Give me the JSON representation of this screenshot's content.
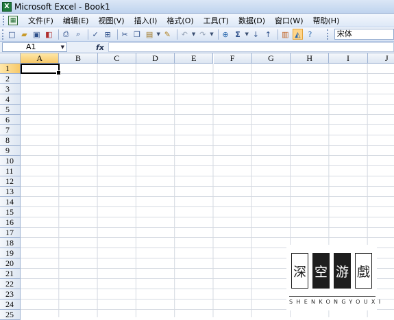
{
  "window": {
    "title": "Microsoft Excel - Book1",
    "app_icon": "excel-icon"
  },
  "menu": [
    {
      "label": "文件(F)"
    },
    {
      "label": "编辑(E)"
    },
    {
      "label": "视图(V)"
    },
    {
      "label": "插入(I)"
    },
    {
      "label": "格式(O)"
    },
    {
      "label": "工具(T)"
    },
    {
      "label": "数据(D)"
    },
    {
      "label": "窗口(W)"
    },
    {
      "label": "帮助(H)"
    }
  ],
  "toolbar": {
    "font_name": "宋体"
  },
  "formula_bar": {
    "cell_ref": "A1",
    "fx_label": "fx",
    "value": ""
  },
  "grid": {
    "columns": [
      "A",
      "B",
      "C",
      "D",
      "E",
      "F",
      "G",
      "H",
      "I",
      "J"
    ],
    "rows": [
      "1",
      "2",
      "3",
      "4",
      "5",
      "6",
      "7",
      "8",
      "9",
      "10",
      "11",
      "12",
      "13",
      "14",
      "15",
      "16",
      "17",
      "18",
      "19",
      "20",
      "21",
      "22",
      "23",
      "24",
      "25"
    ],
    "active_column": "A",
    "active_row": "1"
  },
  "watermark": {
    "chars": [
      "深",
      "空",
      "游",
      "戲"
    ],
    "caption": "SHENKONGYOUXI"
  }
}
